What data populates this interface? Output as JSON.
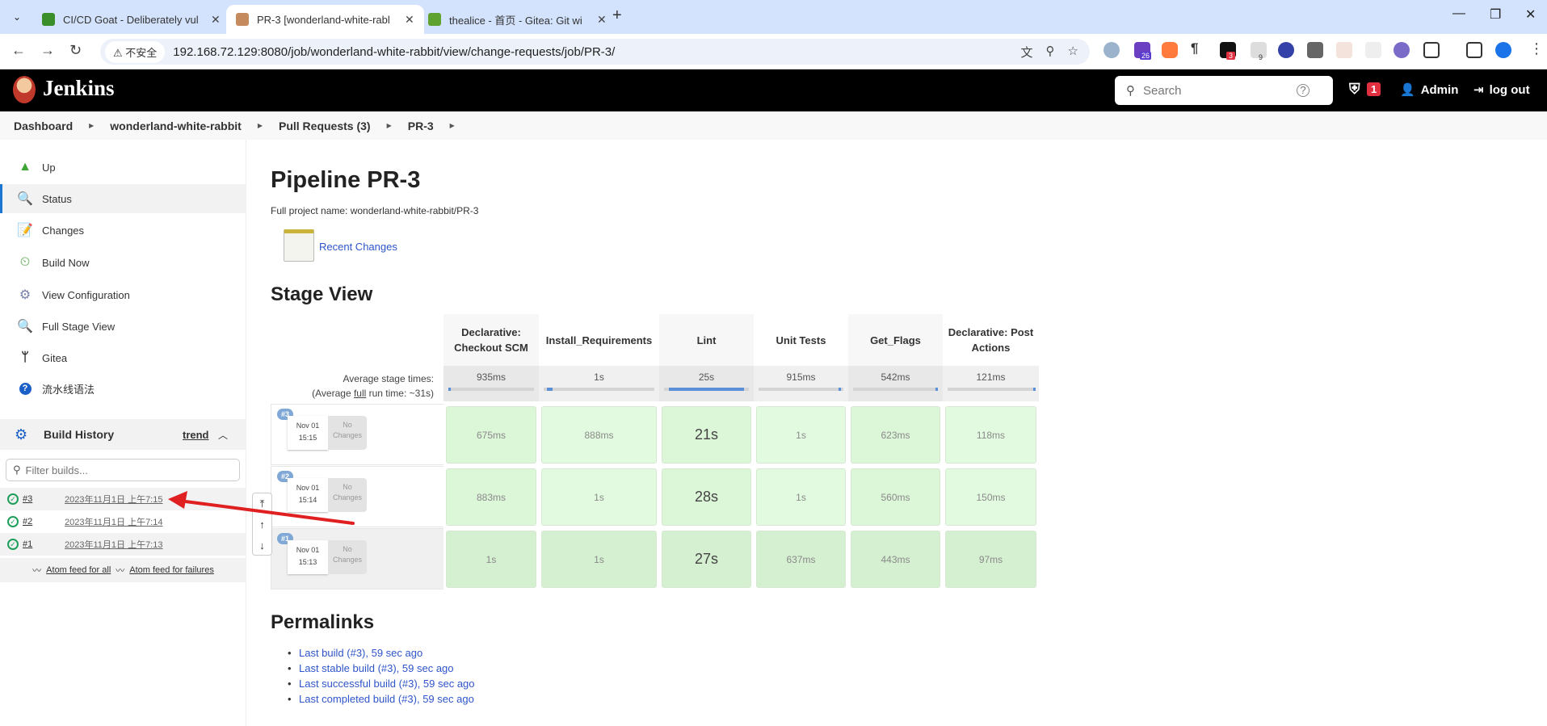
{
  "browser": {
    "tabs": [
      {
        "title": "CI/CD Goat - Deliberately vul",
        "active": false,
        "favicon_color": "#3a8f2b"
      },
      {
        "title": "PR-3 [wonderland-white-rabl",
        "active": true,
        "favicon_color": "#c58a5e"
      },
      {
        "title": "thealice - 首页 - Gitea: Git wi",
        "active": false,
        "favicon_color": "#5fa22f"
      }
    ],
    "insecure_label": "⚠ 不安全",
    "url": "192.168.72.129:8080/job/wonderland-white-rabbit/view/change-requests/job/PR-3/",
    "extension_badges": {
      "purple": "26",
      "red": "3",
      "gray": "9"
    }
  },
  "header": {
    "brand": "Jenkins",
    "search_placeholder": "Search",
    "security_alert_count": "1",
    "user": "Admin",
    "logout": "log out"
  },
  "breadcrumb": [
    "Dashboard",
    "wonderland-white-rabbit",
    "Pull Requests (3)",
    "PR-3"
  ],
  "sidebar": {
    "items": [
      {
        "label": "Up",
        "icon": "up-arrow-icon"
      },
      {
        "label": "Status",
        "icon": "magnifier-icon",
        "active": true
      },
      {
        "label": "Changes",
        "icon": "notepad-icon"
      },
      {
        "label": "Build Now",
        "icon": "clock-play-icon"
      },
      {
        "label": "View Configuration",
        "icon": "gear-icon"
      },
      {
        "label": "Full Stage View",
        "icon": "magnifier-icon"
      },
      {
        "label": "Gitea",
        "icon": "branch-icon"
      },
      {
        "label": "流水线语法",
        "icon": "help-icon"
      }
    ],
    "build_history": {
      "title": "Build History",
      "trend": "trend",
      "filter_placeholder": "Filter builds...",
      "builds": [
        {
          "number": "#3",
          "date": "2023年11月1日 上午7:15",
          "status": "success"
        },
        {
          "number": "#2",
          "date": "2023年11月1日 上午7:14",
          "status": "success"
        },
        {
          "number": "#1",
          "date": "2023年11月1日 上午7:13",
          "status": "success"
        }
      ],
      "feed_all": "Atom feed for all",
      "feed_failures": "Atom feed for failures"
    }
  },
  "main": {
    "title": "Pipeline PR-3",
    "full_name": "Full project name: wonderland-white-rabbit/PR-3",
    "recent_changes": "Recent Changes",
    "stage_view_title": "Stage View",
    "avg_stage_label": "Average stage times:",
    "avg_full_prefix": "(Average ",
    "avg_full_link": "full",
    "avg_full_suffix": " run time: ~31s)",
    "stages": [
      {
        "name": "Declarative: Checkout SCM",
        "avg": "935ms",
        "bar_start": 0.0,
        "bar_frac": 0.03
      },
      {
        "name": "Install_Requirements",
        "avg": "1s",
        "bar_start": 0.03,
        "bar_frac": 0.05
      },
      {
        "name": "Lint",
        "avg": "25s",
        "bar_start": 0.06,
        "bar_frac": 0.88
      },
      {
        "name": "Unit Tests",
        "avg": "915ms",
        "bar_start": 0.94,
        "bar_frac": 0.03
      },
      {
        "name": "Get_Flags",
        "avg": "542ms",
        "bar_start": 0.97,
        "bar_frac": 0.02
      },
      {
        "name": "Declarative: Post Actions",
        "avg": "121ms",
        "bar_start": 0.99,
        "bar_frac": 0.01
      }
    ],
    "runs": [
      {
        "badge": "#3",
        "date": "Nov 01",
        "time": "15:15",
        "changes": "No Changes",
        "times": [
          "675ms",
          "888ms",
          "21s",
          "1s",
          "623ms",
          "118ms"
        ]
      },
      {
        "badge": "#2",
        "date": "Nov 01",
        "time": "15:14",
        "changes": "No Changes",
        "times": [
          "883ms",
          "1s",
          "28s",
          "1s",
          "560ms",
          "150ms"
        ]
      },
      {
        "badge": "#1",
        "date": "Nov 01",
        "time": "15:13",
        "changes": "No Changes",
        "times": [
          "1s",
          "1s",
          "27s",
          "637ms",
          "443ms",
          "97ms"
        ]
      }
    ],
    "permalinks_title": "Permalinks",
    "permalinks": [
      "Last build (#3), 59 sec ago",
      "Last stable build (#3), 59 sec ago",
      "Last successful build (#3), 59 sec ago",
      "Last completed build (#3), 59 sec ago"
    ]
  },
  "colors": {
    "accent": "#1a76d2",
    "link": "#2e55c9",
    "success_cell": "#e2fbe0",
    "success_cell_dark": "#d5f0d1",
    "annotation_arrow": "#e02020"
  }
}
